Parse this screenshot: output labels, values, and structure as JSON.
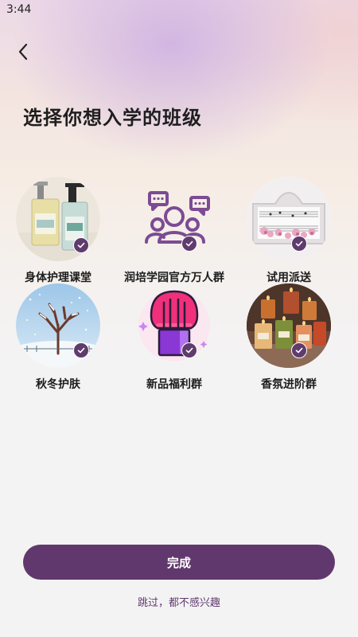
{
  "status_bar": {
    "time": "3:44"
  },
  "header": {
    "back_icon": "chevron-left-icon"
  },
  "page": {
    "title": "选择你想入学的班级"
  },
  "classes": [
    {
      "label": "身体护理课堂",
      "selected": true,
      "image": "body-care-bottles"
    },
    {
      "label": "润培学园官方万人群",
      "selected": true,
      "image": "group-people-chat-icon"
    },
    {
      "label": "试用派送",
      "selected": true,
      "image": "music-sheet-frame"
    },
    {
      "label": "秋冬护肤",
      "selected": true,
      "image": "winter-tree-snow"
    },
    {
      "label": "新品福利群",
      "selected": true,
      "image": "makeup-brush-icon"
    },
    {
      "label": "香氛进阶群",
      "selected": true,
      "image": "scented-candles"
    }
  ],
  "actions": {
    "done_label": "完成",
    "skip_label": "跳过，都不感兴趣"
  },
  "colors": {
    "accent": "#61386d",
    "background": "#f4f3f4",
    "title": "#1e1e1e"
  }
}
